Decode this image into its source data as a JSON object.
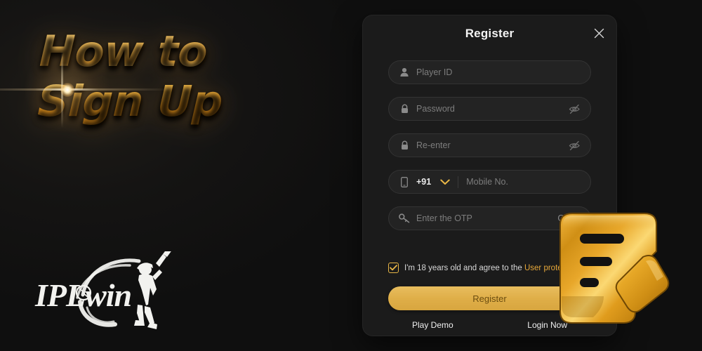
{
  "banner": {
    "title": "How to\nSign Up",
    "brand_logo_text": "IPLwin",
    "accent_gold": "#e9a233"
  },
  "modal": {
    "title": "Register",
    "close_icon": "close-icon",
    "fields": [
      {
        "id": "player_id",
        "icon": "user-icon",
        "placeholder": "Player ID",
        "value": ""
      },
      {
        "id": "password",
        "icon": "lock-icon",
        "placeholder": "Password",
        "value": "",
        "toggle_icon": "eye-slash-icon"
      },
      {
        "id": "reenter",
        "icon": "lock-icon",
        "placeholder": "Re-enter",
        "value": "",
        "toggle_icon": "eye-slash-icon"
      },
      {
        "id": "mobile",
        "icon": "mobile-icon",
        "placeholder": "Mobile No.",
        "value": "",
        "country_code": "+91",
        "chevron_icon": "chevron-down-icon"
      },
      {
        "id": "otp",
        "icon": "key-icon",
        "placeholder": "Enter the OTP",
        "value": "",
        "action_label": "Get C"
      }
    ],
    "agreement": {
      "checked": true,
      "text_before": "I'm 18 years old and agree to the ",
      "link_text": "User prote",
      "link_color": "#e8a93a"
    },
    "register_label": "Register",
    "play_demo_label": "Play Demo",
    "login_now_label": "Login Now",
    "button_color": "#dfae48"
  },
  "overlay": {
    "badge_icon": "registration-form-pen-icon",
    "badge_color": "#e2a41f"
  }
}
